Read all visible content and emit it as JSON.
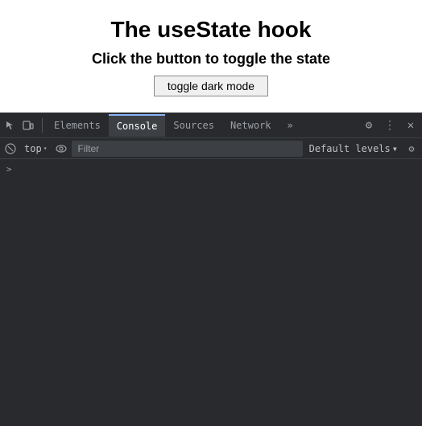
{
  "browser": {
    "main_title": "The useState hook",
    "sub_title": "Click the button to toggle the state",
    "toggle_button_label": "toggle dark mode"
  },
  "devtools": {
    "tabs": [
      {
        "id": "elements",
        "label": "Elements",
        "active": false
      },
      {
        "id": "console",
        "label": "Console",
        "active": true
      },
      {
        "id": "sources",
        "label": "Sources",
        "active": false
      },
      {
        "id": "network",
        "label": "Network",
        "active": false
      },
      {
        "id": "more",
        "label": "»",
        "active": false
      }
    ],
    "toolbar": {
      "context_selector": "top",
      "filter_placeholder": "Filter",
      "levels_label": "Default levels",
      "levels_arrow": "▾"
    },
    "icons": {
      "cursor": "⬚",
      "device": "▣",
      "ban": "⊘",
      "eye": "👁",
      "gear_tab": "⚙",
      "more_vert": "⋮",
      "close": "✕",
      "gear_toolbar": "⚙"
    },
    "console": {
      "prompt_chevron": ">"
    }
  }
}
